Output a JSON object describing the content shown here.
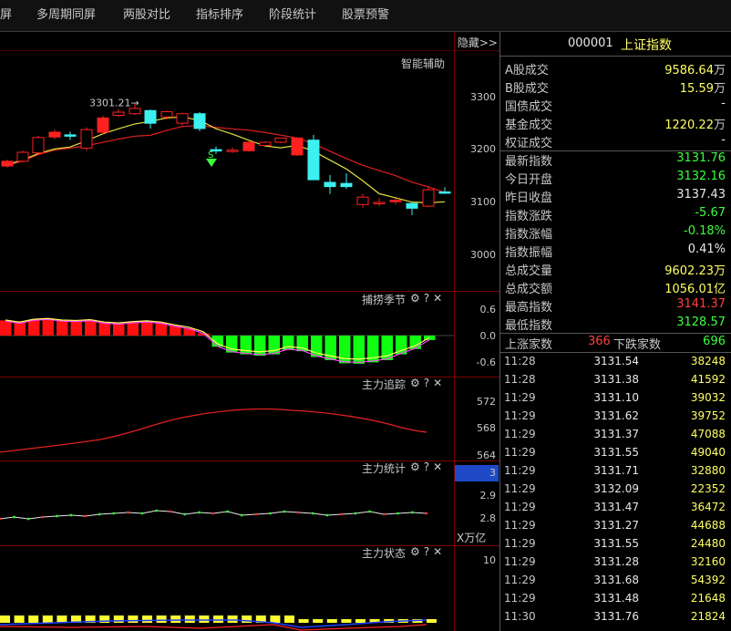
{
  "top_tabs": [
    "屏",
    "多周期同屏",
    "两股对比",
    "指标排序",
    "阶段统计",
    "股票预警"
  ],
  "hide_label": "隐藏>>",
  "stock": {
    "code": "000001",
    "name": "上证指数"
  },
  "main_panel": {
    "label": "智能辅助",
    "high_label": "3301.21",
    "y_ticks": [
      "3300",
      "3200",
      "3100",
      "3000"
    ],
    "marker_letter": "S"
  },
  "indicator_panels": [
    {
      "title": "捕捞季节",
      "y_ticks": [
        "0.6",
        "0.0",
        "-0.6"
      ]
    },
    {
      "title": "主力追踪",
      "y_ticks": [
        "572",
        "568",
        "564"
      ]
    },
    {
      "title": "主力统计",
      "y_ticks": [
        "3",
        "2.9",
        "2.8"
      ],
      "unit": "X万亿"
    },
    {
      "title": "主力状态",
      "y_ticks": [
        "10"
      ]
    }
  ],
  "tool_icons": [
    "gear-icon",
    "help-icon",
    "close-icon"
  ],
  "tool_glyphs": [
    "⚙",
    "?",
    "✕"
  ],
  "summary": [
    {
      "label": "A股成交",
      "value": "9586.64",
      "unit": "万",
      "color": "#ffff66"
    },
    {
      "label": "B股成交",
      "value": "15.59",
      "unit": "万",
      "color": "#ffff66"
    },
    {
      "label": "国债成交",
      "value": "-",
      "unit": "",
      "color": "#e8e8e8"
    },
    {
      "label": "基金成交",
      "value": "1220.22",
      "unit": "万",
      "color": "#ffff66"
    },
    {
      "label": "权证成交",
      "value": "-",
      "unit": "",
      "color": "#e8e8e8"
    }
  ],
  "quotes": [
    {
      "label": "最新指数",
      "value": "3131.76",
      "color": "#3cff3c"
    },
    {
      "label": "今日开盘",
      "value": "3132.16",
      "color": "#3cff3c"
    },
    {
      "label": "昨日收盘",
      "value": "3137.43",
      "color": "#e8e8e8"
    },
    {
      "label": "指数涨跌",
      "value": "-5.67",
      "color": "#3cff3c"
    },
    {
      "label": "指数涨幅",
      "value": "-0.18%",
      "color": "#3cff3c"
    },
    {
      "label": "指数振幅",
      "value": "0.41%",
      "color": "#e8e8e8"
    },
    {
      "label": "总成交量",
      "value": "9602.23万",
      "color": "#ffff66"
    },
    {
      "label": "总成交额",
      "value": "1056.01亿",
      "color": "#ffff66"
    },
    {
      "label": "最高指数",
      "value": "3141.37",
      "color": "#ff4040"
    },
    {
      "label": "最低指数",
      "value": "3128.57",
      "color": "#3cff3c"
    }
  ],
  "breadth": {
    "up_label": "上涨家数",
    "up_value": "366",
    "down_label": "下跌家数",
    "down_value": "696"
  },
  "ticks": [
    {
      "time": "11:28",
      "price": "3131.54",
      "vol": "38248"
    },
    {
      "time": "11:28",
      "price": "3131.38",
      "vol": "41592"
    },
    {
      "time": "11:29",
      "price": "3131.10",
      "vol": "39032"
    },
    {
      "time": "11:29",
      "price": "3131.62",
      "vol": "39752"
    },
    {
      "time": "11:29",
      "price": "3131.37",
      "vol": "47088"
    },
    {
      "time": "11:29",
      "price": "3131.55",
      "vol": "49040"
    },
    {
      "time": "11:29",
      "price": "3131.71",
      "vol": "32880"
    },
    {
      "time": "11:29",
      "price": "3132.09",
      "vol": "22352"
    },
    {
      "time": "11:29",
      "price": "3131.47",
      "vol": "36472"
    },
    {
      "time": "11:29",
      "price": "3131.27",
      "vol": "44688"
    },
    {
      "time": "11:29",
      "price": "3131.55",
      "vol": "24480"
    },
    {
      "time": "11:29",
      "price": "3131.28",
      "vol": "32160"
    },
    {
      "time": "11:29",
      "price": "3131.68",
      "vol": "54392"
    },
    {
      "time": "11:29",
      "price": "3131.48",
      "vol": "21648"
    },
    {
      "time": "11:30",
      "price": "3131.76",
      "vol": "21824"
    }
  ],
  "chart_data": {
    "type": "candlestick",
    "y_range": [
      2960,
      3340
    ],
    "candles": [
      {
        "o": 3185,
        "h": 3192,
        "l": 3182,
        "c": 3188
      },
      {
        "o": 3188,
        "h": 3196,
        "l": 3178,
        "c": 3192
      },
      {
        "o": 3181,
        "h": 3193,
        "l": 3178,
        "c": 3190
      },
      {
        "o": 3190,
        "h": 3210,
        "l": 3188,
        "c": 3207
      },
      {
        "o": 3206,
        "h": 3238,
        "l": 3202,
        "c": 3235
      },
      {
        "o": 3236,
        "h": 3250,
        "l": 3232,
        "c": 3245
      },
      {
        "o": 3240,
        "h": 3246,
        "l": 3230,
        "c": 3238
      },
      {
        "o": 3215,
        "h": 3254,
        "l": 3210,
        "c": 3250
      },
      {
        "o": 3245,
        "h": 3276,
        "l": 3240,
        "c": 3272
      },
      {
        "o": 3277,
        "h": 3289,
        "l": 3274,
        "c": 3283
      },
      {
        "o": 3280,
        "h": 3301,
        "l": 3278,
        "c": 3290
      },
      {
        "o": 3286,
        "h": 3288,
        "l": 3252,
        "c": 3262
      },
      {
        "o": 3274,
        "h": 3286,
        "l": 3269,
        "c": 3284
      },
      {
        "o": 3262,
        "h": 3282,
        "l": 3258,
        "c": 3280
      },
      {
        "o": 3280,
        "h": 3283,
        "l": 3247,
        "c": 3252
      },
      {
        "o": 3212,
        "h": 3218,
        "l": 3204,
        "c": 3210
      },
      {
        "o": 3210,
        "h": 3216,
        "l": 3206,
        "c": 3211
      },
      {
        "o": 3210,
        "h": 3228,
        "l": 3208,
        "c": 3226
      },
      {
        "o": 3220,
        "h": 3228,
        "l": 3220,
        "c": 3226
      },
      {
        "o": 3226,
        "h": 3234,
        "l": 3224,
        "c": 3234
      },
      {
        "o": 3202,
        "h": 3236,
        "l": 3200,
        "c": 3234
      },
      {
        "o": 3230,
        "h": 3240,
        "l": 3158,
        "c": 3155
      },
      {
        "o": 3150,
        "h": 3164,
        "l": 3128,
        "c": 3142
      },
      {
        "o": 3148,
        "h": 3167,
        "l": 3138,
        "c": 3142
      },
      {
        "o": 3108,
        "h": 3128,
        "l": 3102,
        "c": 3122
      },
      {
        "o": 3111,
        "h": 3120,
        "l": 3105,
        "c": 3112
      },
      {
        "o": 3114,
        "h": 3120,
        "l": 3108,
        "c": 3116
      },
      {
        "o": 3110,
        "h": 3112,
        "l": 3088,
        "c": 3101
      },
      {
        "o": 3105,
        "h": 3142,
        "l": 3103,
        "c": 3136
      },
      {
        "o": 3132,
        "h": 3141,
        "l": 3128,
        "c": 3131
      }
    ],
    "catch_season": [
      0.34,
      0.29,
      0.36,
      0.38,
      0.34,
      0.33,
      0.35,
      0.29,
      0.27,
      0.3,
      0.32,
      0.29,
      0.22,
      0.16,
      0.05,
      -0.25,
      -0.38,
      -0.42,
      -0.45,
      -0.42,
      -0.32,
      -0.35,
      -0.48,
      -0.55,
      -0.62,
      -0.63,
      -0.6,
      -0.55,
      -0.42,
      -0.3,
      -0.1
    ]
  }
}
